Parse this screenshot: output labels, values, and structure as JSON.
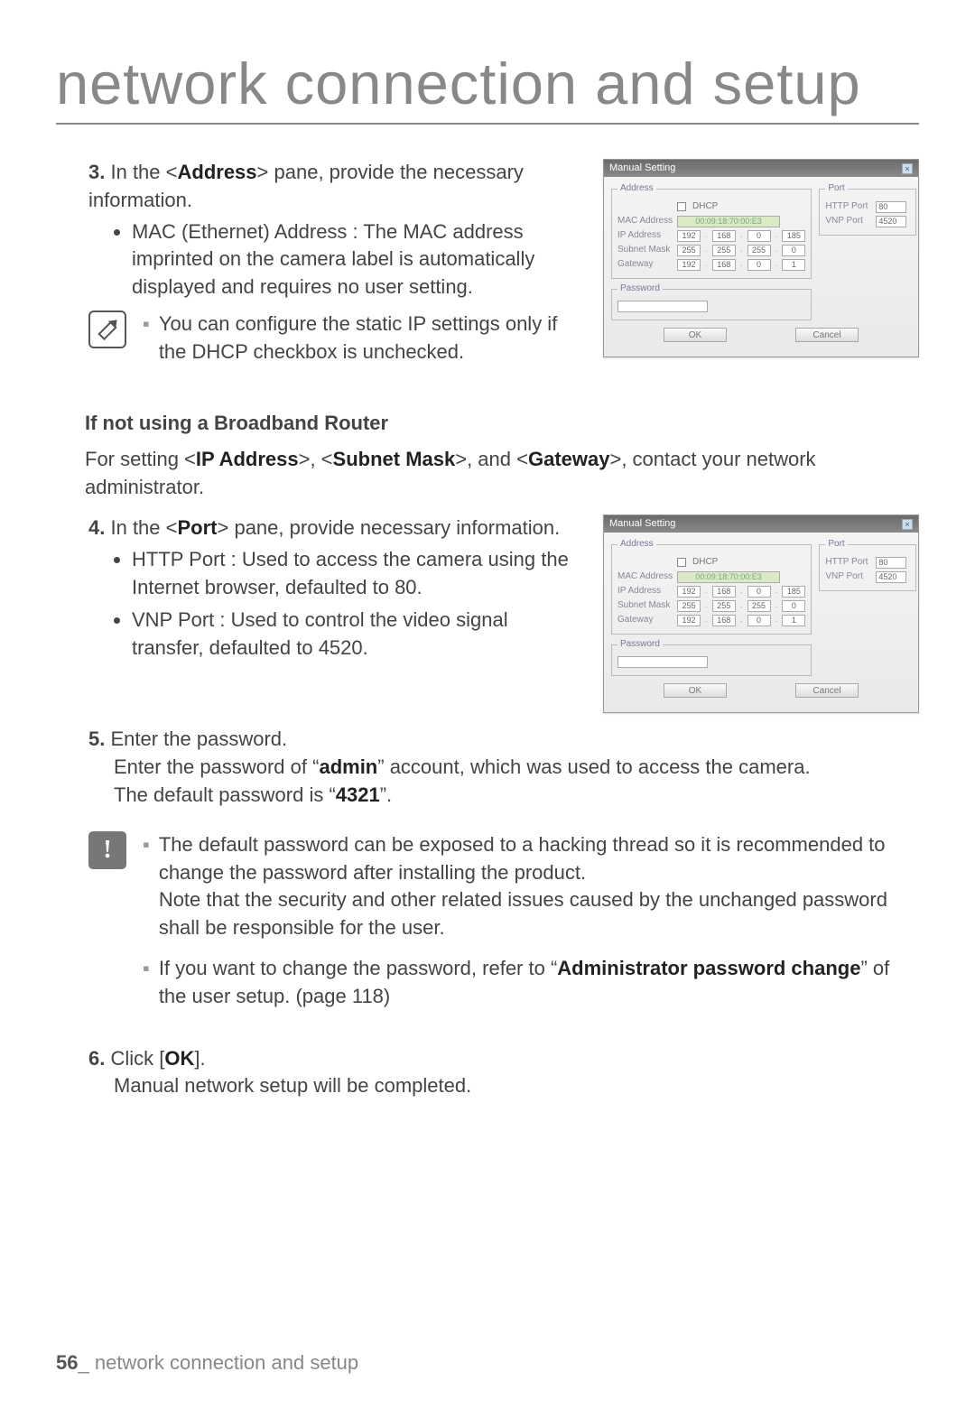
{
  "title": "network connection and setup",
  "step3": {
    "num": "3.",
    "lead_a": "In the <",
    "lead_bold": "Address",
    "lead_b": "> pane, provide the necessary information.",
    "bullet1": "MAC (Ethernet) Address : The MAC address imprinted on the camera label is automatically displayed and requires no user setting."
  },
  "note1": "You can configure the static IP settings only if the DHCP checkbox is unchecked.",
  "sub_head": "If not using a Broadband Router",
  "sub_para_a": "For setting <",
  "sub_b1": "IP Address",
  "sub_m1": ">, <",
  "sub_b2": "Subnet Mask",
  "sub_m2": ">, and <",
  "sub_b3": "Gateway",
  "sub_para_b": ">, contact your network administrator.",
  "step4": {
    "num": "4.",
    "lead_a": "In the <",
    "lead_bold": "Port",
    "lead_b": "> pane, provide necessary information.",
    "bullet1": "HTTP Port : Used to access the camera using the Internet browser, defaulted to 80.",
    "bullet2": "VNP Port : Used to control the video signal transfer, defaulted to 4520."
  },
  "step5": {
    "num": "5.",
    "l1": "Enter the password.",
    "l2a": "Enter the password of “",
    "l2b": "admin",
    "l2c": "” account, which was used to access the camera.",
    "l3a": "The default password is “",
    "l3b": "4321",
    "l3c": "”."
  },
  "warn": {
    "a": "The default password can be exposed to a hacking thread so it is recommended to change the password after installing the product.",
    "b": "Note that the security and other related issues caused by the unchanged password shall be responsible for the user.",
    "c_a": "If you want to change the password, refer to “",
    "c_bold": "Administrator password change",
    "c_b": "” of the user setup. (page 118)"
  },
  "step6": {
    "num": "6.",
    "a": "Click [",
    "bold": "OK",
    "b": "].",
    "l2": "Manual network setup will be completed."
  },
  "footer": {
    "page": "56",
    "sep": "_ ",
    "text": "network connection and setup"
  },
  "shot": {
    "title": "Manual Setting",
    "legend_addr": "Address",
    "legend_port": "Port",
    "legend_pw": "Password",
    "dhcp": "DHCP",
    "mac_label": "MAC Address",
    "mac_value": "00:09:18:70:00:E3",
    "ip_label": "IP Address",
    "ip": [
      "192",
      "168",
      "0",
      "185"
    ],
    "sm_label": "Subnet Mask",
    "sm": [
      "255",
      "255",
      "255",
      "0"
    ],
    "gw_label": "Gateway",
    "gw": [
      "192",
      "168",
      "0",
      "1"
    ],
    "http_label": "HTTP Port",
    "http_val": "80",
    "vnp_label": "VNP Port",
    "vnp_val": "4520",
    "ok": "OK",
    "cancel": "Cancel"
  }
}
